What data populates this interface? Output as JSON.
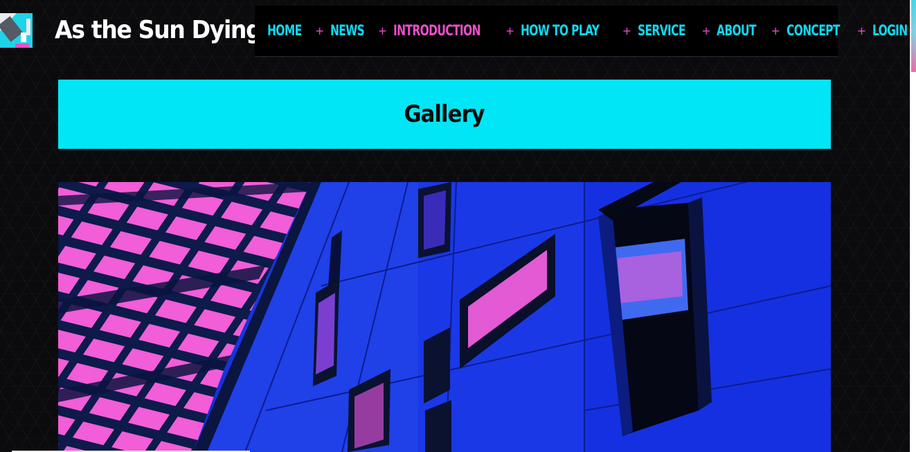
{
  "site": {
    "title": "As the Sun Dying",
    "logo_icon": "game-logo-icon"
  },
  "nav": {
    "items": [
      {
        "label": "HOME",
        "active": false
      },
      {
        "label": "NEWS",
        "active": false
      },
      {
        "label": "INTRODUCTION",
        "active": true
      },
      {
        "label": "HOW TO PLAY",
        "active": false
      },
      {
        "label": "SERVICE",
        "active": false
      },
      {
        "label": "ABOUT",
        "active": false
      },
      {
        "label": "CONCEPT",
        "active": false
      },
      {
        "label": "LOGIN",
        "active": false
      }
    ],
    "separator": "+",
    "color": "#10d8f0",
    "active_color": "#e84fc9"
  },
  "gallery": {
    "title": "Gallery",
    "banner_color": "#00e6f6"
  },
  "colors": {
    "background": "#0b0b0d",
    "accent_cyan": "#00e6f6",
    "accent_pink": "#e84fc9",
    "image_blue": "#1530e0"
  }
}
